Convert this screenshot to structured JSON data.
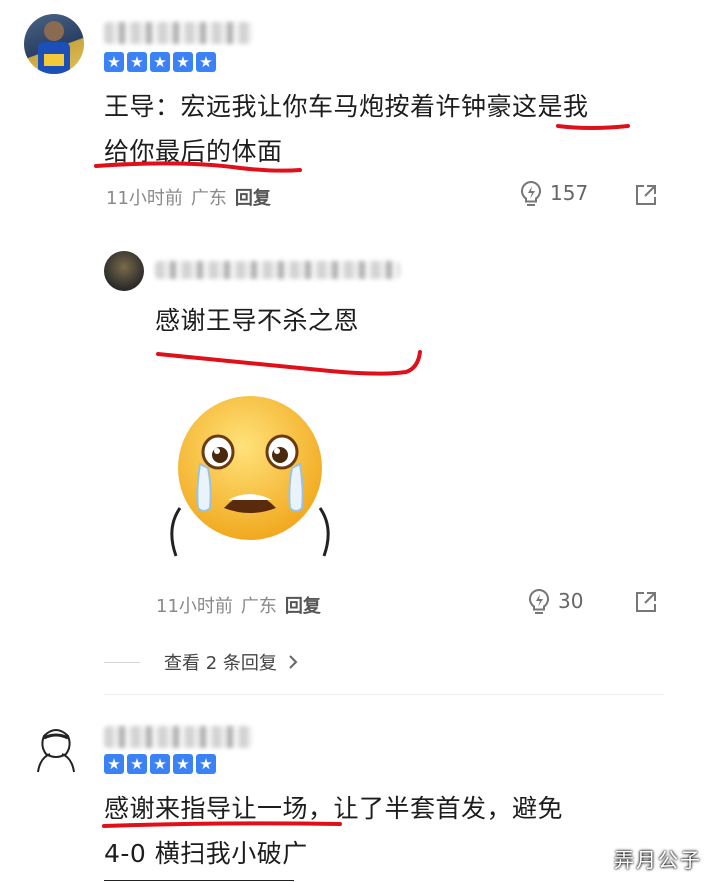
{
  "comments": [
    {
      "stars": 5,
      "text_line1": "王导：宏远我让你车马炮按着许钟豪这是我",
      "text_line2": "给你最后的体面",
      "time": "11小时前",
      "location": "广东",
      "reply_label": "回复",
      "likes": "157"
    },
    {
      "text": "感谢王导不杀之恩",
      "time": "11小时前",
      "location": "广东",
      "reply_label": "回复",
      "likes": "30",
      "sticker": "crying-face-emoji"
    },
    {
      "stars": 5,
      "text_line1": "感谢来指导让一场，让了半套首发，避免",
      "text_line2": "4-0 横扫我小破广"
    }
  ],
  "view_replies": "查看 2 条回复",
  "watermark": "弄月公子",
  "colors": {
    "star_blue": "#3b82f6",
    "underline_red": "#e0101a",
    "meta_gray": "#8a8a8a"
  },
  "icons": [
    "lightbulb-icon",
    "share-icon",
    "chevron-right-icon"
  ]
}
